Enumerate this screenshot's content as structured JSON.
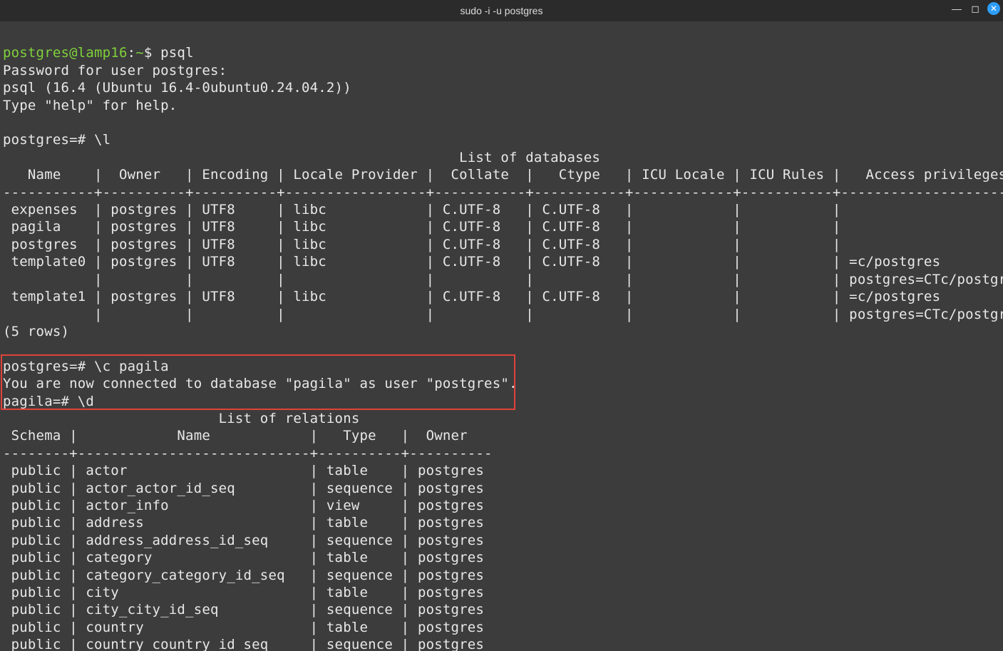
{
  "window": {
    "title": "sudo -i -u postgres"
  },
  "lines": {
    "l1a": "postgres@lamp16",
    "l1b": ":",
    "l1c": "~",
    "l1d": "$ psql",
    "l2": "Password for user postgres:",
    "l3": "psql (16.4 (Ubuntu 16.4-0ubuntu0.24.04.2))",
    "l4": "Type \"help\" for help.",
    "blank": "",
    "p1": "postgres=# \\l",
    "dbtitle": "                                                       List of databases",
    "dbhdr": "   Name    |  Owner   | Encoding | Locale Provider |  Collate  |   Ctype   | ICU Locale | ICU Rules |   Access privileges   ",
    "dbsep": "-----------+----------+----------+-----------------+-----------+-----------+------------+-----------+-----------------------",
    "dbr1": " expenses  | postgres | UTF8     | libc            | C.UTF-8   | C.UTF-8   |            |           | ",
    "dbr2": " pagila    | postgres | UTF8     | libc            | C.UTF-8   | C.UTF-8   |            |           | ",
    "dbr3": " postgres  | postgres | UTF8     | libc            | C.UTF-8   | C.UTF-8   |            |           | ",
    "dbr4": " template0 | postgres | UTF8     | libc            | C.UTF-8   | C.UTF-8   |            |           | =c/postgres          +",
    "dbr4b": "           |          |          |                 |           |           |            |           | postgres=CTc/postgres",
    "dbr5": " template1 | postgres | UTF8     | libc            | C.UTF-8   | C.UTF-8   |            |           | =c/postgres          +",
    "dbr5b": "           |          |          |                 |           |           |            |           | postgres=CTc/postgres",
    "dbcount": "(5 rows)",
    "p2": "postgres=# \\c pagila",
    "conn": "You are now connected to database \"pagila\" as user \"postgres\".",
    "p3": "pagila=# \\d",
    "reltitle": "                          List of relations",
    "relhdr": " Schema |            Name            |   Type   |  Owner   ",
    "relsep": "--------+----------------------------+----------+----------",
    "rr1": " public | actor                      | table    | postgres",
    "rr2": " public | actor_actor_id_seq         | sequence | postgres",
    "rr3": " public | actor_info                 | view     | postgres",
    "rr4": " public | address                    | table    | postgres",
    "rr5": " public | address_address_id_seq     | sequence | postgres",
    "rr6": " public | category                   | table    | postgres",
    "rr7": " public | category_category_id_seq   | sequence | postgres",
    "rr8": " public | city                       | table    | postgres",
    "rr9": " public | city_city_id_seq           | sequence | postgres",
    "rr10": " public | country                    | table    | postgres",
    "rr11": " public | country_country_id_seq     | sequence | postgres"
  }
}
